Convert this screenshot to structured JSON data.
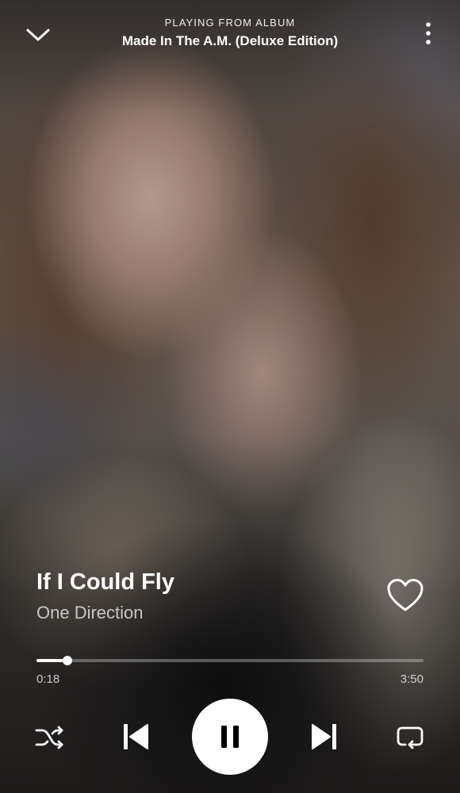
{
  "header": {
    "context_label": "PLAYING FROM ALBUM",
    "context_title": "Made In The A.M. (Deluxe Edition)",
    "collapse_icon": "chevron-down-icon",
    "more_icon": "more-vertical-icon"
  },
  "track": {
    "title": "If I Could Fly",
    "artist": "One Direction",
    "liked": false,
    "like_icon": "heart-outline-icon"
  },
  "progress": {
    "elapsed": "0:18",
    "total": "3:50",
    "fraction": 0.08
  },
  "controls": {
    "shuffle_icon": "shuffle-icon",
    "previous_icon": "skip-previous-icon",
    "play_pause_icon": "pause-icon",
    "next_icon": "skip-next-icon",
    "repeat_icon": "repeat-icon"
  },
  "colors": {
    "primary_text": "#ffffff",
    "secondary_text": "#b8b2ad",
    "progress_track": "#6e6864",
    "play_button": "#ffffff",
    "play_icon": "#000000"
  }
}
